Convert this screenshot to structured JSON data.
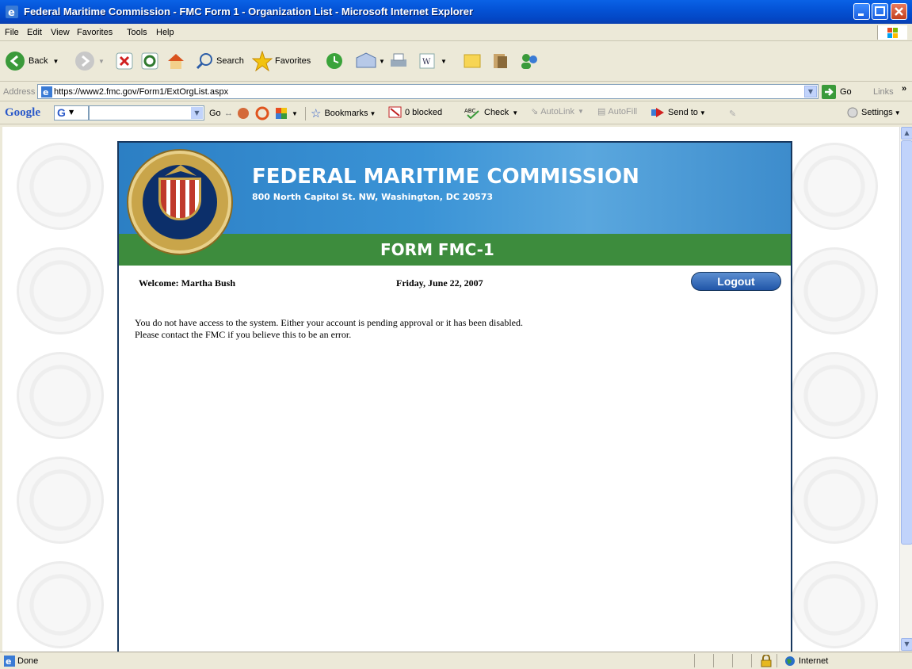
{
  "window": {
    "title": "Federal Maritime Commission - FMC Form 1 - Organization List - Microsoft Internet Explorer"
  },
  "menu": [
    "File",
    "Edit",
    "View",
    "Favorites",
    "Tools",
    "Help"
  ],
  "toolbar": {
    "back": "Back",
    "search": "Search",
    "favorites": "Favorites"
  },
  "address": {
    "label": "Address",
    "url": "https://www2.fmc.gov/Form1/ExtOrgList.aspx",
    "go": "Go",
    "links": "Links"
  },
  "googlebar": {
    "logo": "Google",
    "go": "Go",
    "bookmarks": "Bookmarks",
    "blocked": "0 blocked",
    "check": "Check",
    "autolink": "AutoLink",
    "autofill": "AutoFill",
    "sendto": "Send to",
    "settings": "Settings"
  },
  "page": {
    "header_title": "FEDERAL MARITIME COMMISSION",
    "header_address": "800 North Capitol St. NW, Washington, DC 20573",
    "form_title": "FORM FMC-1",
    "welcome": "Welcome:  Martha Bush",
    "date": "Friday, June 22, 2007",
    "logout": "Logout",
    "message_line1": "You do not have access to the system. Either your account is pending approval or it has been disabled.",
    "message_line2": "Please contact the FMC if you believe this to be an error."
  },
  "status": {
    "left": "Done",
    "zone": "Internet"
  }
}
